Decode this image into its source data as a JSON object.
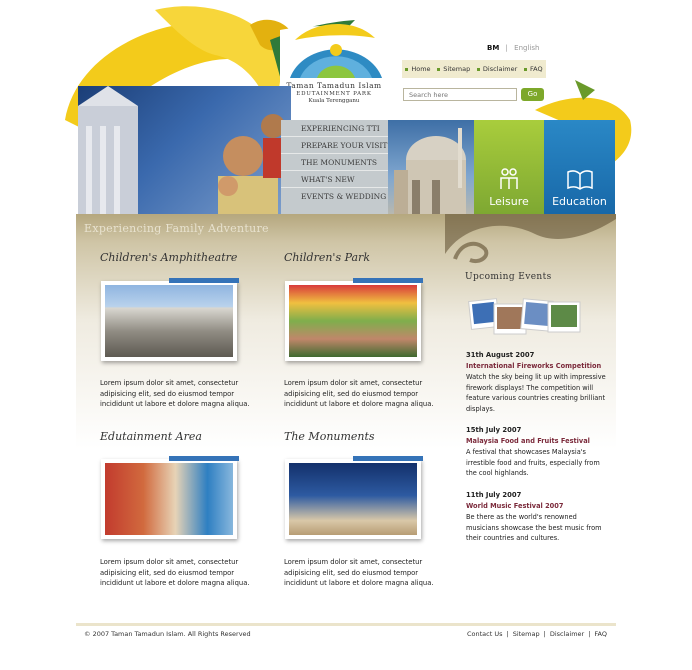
{
  "header": {
    "logo": {
      "line1": "Taman Tamadun Islam",
      "line2": "EDUTAINMENT PARK",
      "line3": "Kuala Terengganu"
    },
    "lang": {
      "active": "BM",
      "inactive": "English",
      "sep": "|"
    },
    "topnav": [
      "Home",
      "Sitemap",
      "Disclaimer",
      "FAQ"
    ],
    "search": {
      "placeholder": "Search here",
      "button": "Go"
    }
  },
  "main_menu": [
    "EXPERIENCING TTI",
    "PREPARE YOUR VISIT",
    "THE MONUMENTS",
    "WHAT'S NEW",
    "EVENTS & WEDDING"
  ],
  "tiles": {
    "leisure": "Leisure",
    "education": "Education"
  },
  "section_title": "Experiencing Family Adventure",
  "features": [
    {
      "title": "Children's Amphitheatre",
      "text": "Lorem ipsum dolor sit amet, consectetur adipisicing elit, sed do eiusmod tempor incididunt ut labore et dolore magna aliqua."
    },
    {
      "title": "Children's Park",
      "text": "Lorem ipsum dolor sit amet, consectetur adipisicing elit, sed do eiusmod tempor incididunt ut labore et dolore magna aliqua."
    },
    {
      "title": "Edutainment Area",
      "text": "Lorem ipsum dolor sit amet, consectetur adipisicing elit, sed do eiusmod tempor incididunt ut labore et dolore magna aliqua."
    },
    {
      "title": "The Monuments",
      "text": "Lorem ipsum dolor sit amet, consectetur adipisicing elit, sed do eiusmod tempor incididunt ut labore et dolore magna aliqua."
    }
  ],
  "events": {
    "title": "Upcoming Events",
    "items": [
      {
        "date": "31th August 2007",
        "name": "International Fireworks Competition",
        "desc": "Watch the sky being lit up with impressive firework displays! The competition will feature various countries creating brilliant displays."
      },
      {
        "date": "15th July 2007",
        "name": "Malaysia Food and Fruits Festival",
        "desc": "A festival that showcases Malaysia's irrestible food and fruits, especially from the cool highlands."
      },
      {
        "date": "11th July 2007",
        "name": "World Music Festival 2007",
        "desc": "Be there as the world's renowned musicians showcase the best music from their countries and cultures."
      }
    ]
  },
  "footer": {
    "copyright": "© 2007 Taman Tamadun Islam. All Rights Reserved",
    "links": [
      "Contact Us",
      "Sitemap",
      "Disclaimer",
      "FAQ"
    ]
  },
  "colors": {
    "green": "#7da82a",
    "blue": "#1868a8",
    "gold": "#f1c21b",
    "maroon": "#7b2a3b",
    "menu": "#c4cacd"
  }
}
